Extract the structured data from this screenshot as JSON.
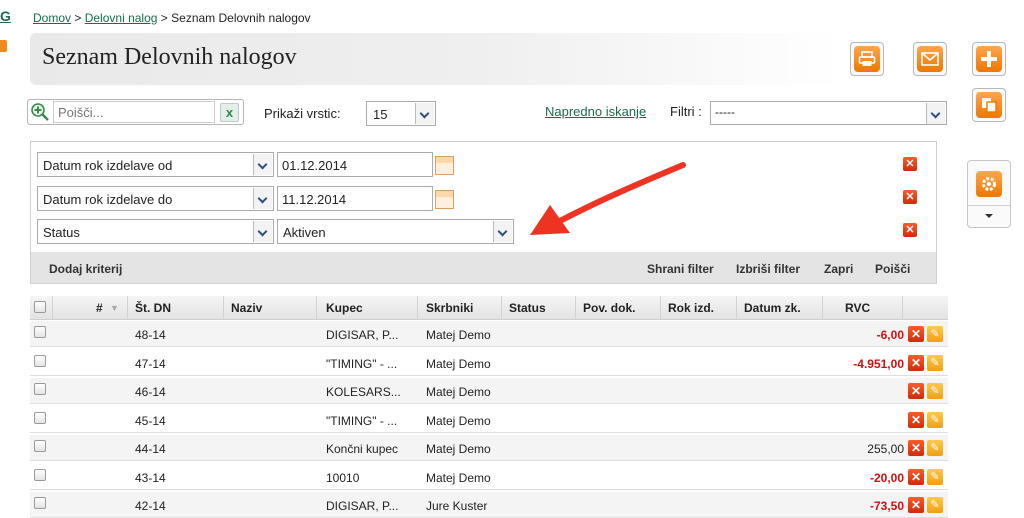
{
  "edge": {
    "letter": "G"
  },
  "breadcrumb": {
    "home": "Domov",
    "sep1": ">",
    "parent": "Delovni nalog",
    "sep2": ">",
    "current": "Seznam Delovnih nalogov"
  },
  "page_title": "Seznam Delovnih nalogov",
  "toolbar": {
    "print_icon": "printer-icon",
    "mail_icon": "envelope-icon",
    "add_icon": "plus-icon",
    "copy_icon": "copy-icon",
    "settings_icon": "gear-icon"
  },
  "search": {
    "placeholder": "Poišči...",
    "clear_label": "x"
  },
  "rows_per_page": {
    "label": "Prikaži vrstic:",
    "value": "15"
  },
  "advanced_search": "Napredno iskanje",
  "filters": {
    "label": "Filtri :",
    "value": "-----"
  },
  "criteria": [
    {
      "field": "Datum rok izdelave od",
      "value": "01.12.2014"
    },
    {
      "field": "Datum rok izdelave do",
      "value": "11.12.2014"
    },
    {
      "field": "Status",
      "value": "Aktiven"
    }
  ],
  "filter_actions": {
    "add": "Dodaj kriterij",
    "save": "Shrani filter",
    "delete": "Izbriši filter",
    "close": "Zapri",
    "search": "Poišči"
  },
  "table": {
    "columns": [
      "#",
      "Št. DN",
      "Naziv",
      "Kupec",
      "Skrbniki",
      "Status",
      "Pov. dok.",
      "Rok izd.",
      "Datum zk.",
      "RVC"
    ],
    "rows": [
      {
        "dn": "48-14",
        "kupec": "DIGISAR, P...",
        "skrbniki": "Matej Demo",
        "rvc": "-6,00",
        "neg": true
      },
      {
        "dn": "47-14",
        "kupec": "\"TIMING\" - ...",
        "skrbniki": "Matej Demo",
        "rvc": "-4.951,00",
        "neg": true
      },
      {
        "dn": "46-14",
        "kupec": "KOLESARS...",
        "skrbniki": "Matej Demo",
        "rvc": "",
        "neg": false
      },
      {
        "dn": "45-14",
        "kupec": "\"TIMING\" - ...",
        "skrbniki": "Matej Demo",
        "rvc": "",
        "neg": false
      },
      {
        "dn": "44-14",
        "kupec": "Končni kupec",
        "skrbniki": "Matej Demo",
        "rvc": "255,00",
        "neg": false
      },
      {
        "dn": "43-14",
        "kupec": "10010",
        "skrbniki": "Matej Demo",
        "rvc": "-20,00",
        "neg": true
      },
      {
        "dn": "42-14",
        "kupec": "DIGISAR, P...",
        "skrbniki": "Jure Kuster",
        "rvc": "-73,50",
        "neg": true
      }
    ]
  },
  "colors": {
    "brand_green": "#1a6b4a",
    "accent_orange": "#f08a1c",
    "negative_red": "#d01010",
    "arrow_red": "#ee3322"
  }
}
